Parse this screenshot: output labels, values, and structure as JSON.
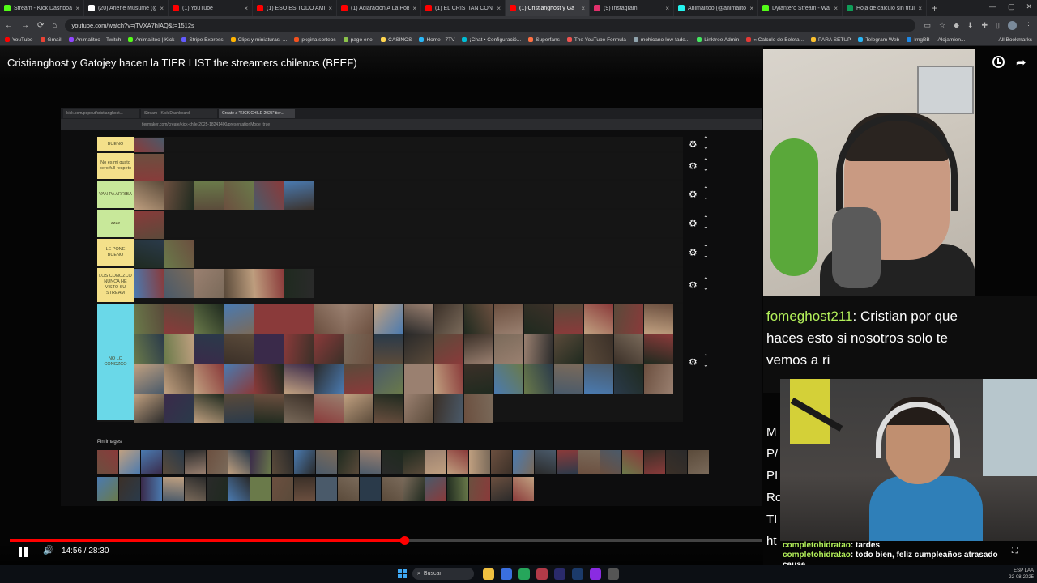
{
  "browser": {
    "tabs": [
      {
        "title": "Stream - Kick Dashboard",
        "color": "#53fc18",
        "active": false
      },
      {
        "title": "(20) Arlene Musume (@a",
        "color": "#ffffff",
        "active": false
      },
      {
        "title": "(1) YouTube",
        "color": "#ff0000",
        "active": false
      },
      {
        "title": "(1) ESO ES TODO AMIGO",
        "color": "#ff0000",
        "active": false
      },
      {
        "title": "(1) Aclaracion A La Polem",
        "color": "#ff0000",
        "active": false
      },
      {
        "title": "(1) EL CRISTIAN CONFIES",
        "color": "#ff0000",
        "active": false
      },
      {
        "title": "(1) Cristianghost y Ga",
        "color": "#ff0000",
        "active": true
      },
      {
        "title": "(9) Instagram",
        "color": "#e1306c",
        "active": false
      },
      {
        "title": "Animalitoo (@animalito",
        "color": "#25f4ee",
        "active": false
      },
      {
        "title": "Dylantero Stream - Watc",
        "color": "#53fc18",
        "active": false
      },
      {
        "title": "Hoja de cálculo sin título",
        "color": "#0f9d58",
        "active": false
      }
    ],
    "url": "youtube.com/watch?v=jTVXA7hIAQ&t=1512s",
    "bookmarks": [
      {
        "label": "YouTube",
        "color": "#ff0000"
      },
      {
        "label": "Gmail",
        "color": "#ea4335"
      },
      {
        "label": "Animalitoo – Twitch",
        "color": "#9146ff"
      },
      {
        "label": "Animalitoo | Kick",
        "color": "#53fc18"
      },
      {
        "label": "Stripe Express",
        "color": "#635bff"
      },
      {
        "label": "Clips y miniaturas -...",
        "color": "#ffb300"
      },
      {
        "label": "pkgina sorteos",
        "color": "#f4511e"
      },
      {
        "label": "pago enel",
        "color": "#8bc34a"
      },
      {
        "label": "CASINOS",
        "color": "#ffd54f"
      },
      {
        "label": "Home - 7TV",
        "color": "#29b6f6"
      },
      {
        "label": "¡Chat • Configuració...",
        "color": "#00bcd4"
      },
      {
        "label": "Superfans",
        "color": "#ff7043"
      },
      {
        "label": "The YouTube Formula",
        "color": "#ef5350"
      },
      {
        "label": "mohicano-low-fade...",
        "color": "#90a4ae"
      },
      {
        "label": "Linktree Admin",
        "color": "#43e660"
      },
      {
        "label": "« Calculo de Boleta...",
        "color": "#e53935"
      },
      {
        "label": "PARA SETUP",
        "color": "#fbc02d"
      },
      {
        "label": "Telegram Web",
        "color": "#29b6f6"
      },
      {
        "label": "ImgBB — Alojamien...",
        "color": "#1e88e5"
      }
    ],
    "all_bookmarks": "All Bookmarks"
  },
  "video": {
    "title": "Cristianghost y Gatojey hacen la TIER LIST the streamers chilenos (BEEF)",
    "current_time": "14:56",
    "duration": "28:30",
    "time_display": "14:56 / 28:30",
    "progress": 0.524
  },
  "inner_screen": {
    "tabs": [
      "kick.com/popout/cristianghost...",
      "Stream - Kick Dashboard",
      "Create a \"KICK CHILE 2025\" tier..."
    ],
    "url": "tiermaker.com/create/kick-chile-2025-18241400/presentationMode_true",
    "pin_label": "Pin Images",
    "tiers": [
      {
        "label": "BUENO",
        "color": "#f4e08a",
        "count": 1
      },
      {
        "label": "No es mi gusto pero full respeto",
        "color": "#f4e08a",
        "count": 1
      },
      {
        "label": "VAN PA ARRIBA",
        "color": "#c8e89a",
        "count": 6
      },
      {
        "label": "zzzz",
        "color": "#c8e89a",
        "count": 1
      },
      {
        "label": "LE PONE BUENO",
        "color": "#f4e08a",
        "count": 2
      },
      {
        "label": "LOS CONOZCO NUNCA HE VISTO SU STREAM",
        "color": "#f4e08a",
        "count": 6
      },
      {
        "label": "NO LO CONOZCO",
        "color": "#6ad8e8",
        "count": 66
      }
    ]
  },
  "chat": {
    "top": {
      "user": "fomeghost211",
      "text": "Cristian por que haces esto si nosotros solo te vemos a ri"
    },
    "side_letters": [
      "M",
      "P/",
      "PI",
      "Ro",
      "TI",
      "ht"
    ],
    "bottom": [
      {
        "user": "completohidratao",
        "text": "tardes"
      },
      {
        "user": "completohidratao",
        "text": "todo bien, feliz cumpleaños atrasado causa"
      }
    ]
  },
  "taskbar": {
    "search_placeholder": "Buscar",
    "tray": {
      "lang": "ESP LAA",
      "time": "22-08-2025"
    }
  },
  "colors": {
    "accent": "#ff0000",
    "kick_green": "#53fc18",
    "chat_username": "#b3f05a"
  }
}
